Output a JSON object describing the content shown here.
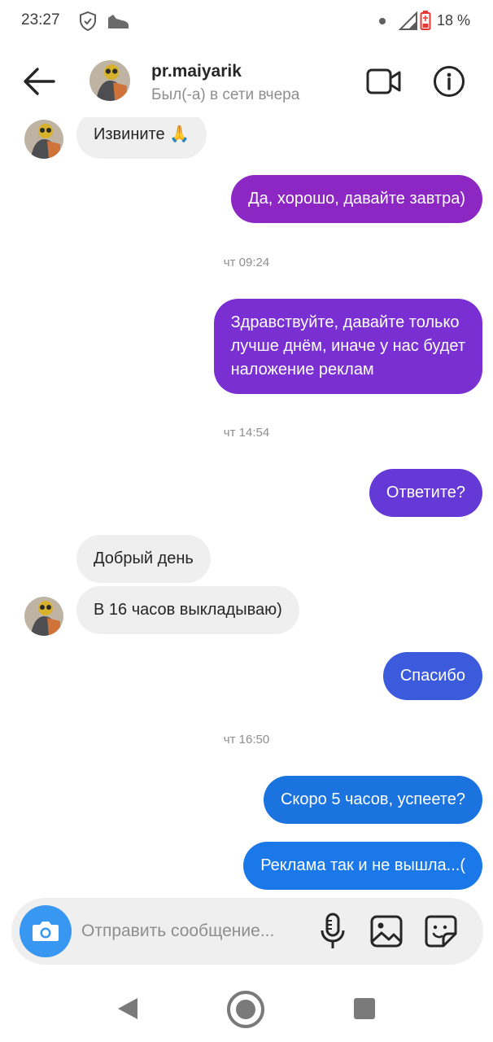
{
  "status_bar": {
    "time": "23:27",
    "battery_percent": "18 %",
    "icons": [
      "shield-icon",
      "shoe-icon",
      "dot-icon",
      "signal-icon",
      "battery-icon"
    ]
  },
  "header": {
    "username": "pr.maiyarik",
    "presence": "Был(-а) в сети вчера",
    "icons": [
      "back-arrow-icon",
      "video-call-icon",
      "info-icon"
    ]
  },
  "messages": [
    {
      "direction": "in",
      "text": "Извините 🙏"
    },
    {
      "direction": "out",
      "text": "Да, хорошо, давайте завтра)",
      "color": "#8c27c4"
    },
    {
      "type": "timestamp",
      "text": "чт 09:24"
    },
    {
      "direction": "out",
      "lines": [
        "Здравствуйте, давайте только",
        "лучше днём, иначе у нас будет",
        "наложение реклам"
      ],
      "color": "#7a2fd2"
    },
    {
      "type": "timestamp",
      "text": "чт 14:54"
    },
    {
      "direction": "out",
      "text": "Ответите?",
      "color": "#6439d6"
    },
    {
      "direction": "in",
      "text": "Добрый день"
    },
    {
      "direction": "in",
      "text": "В 16 часов выкладываю)"
    },
    {
      "direction": "out",
      "text": "Спасибо",
      "color": "#3c5bdc"
    },
    {
      "type": "timestamp",
      "text": "чт 16:50"
    },
    {
      "direction": "out",
      "text": "Скоро 5 часов, успеете?",
      "color": "#1b73e0"
    },
    {
      "direction": "out",
      "text": "Реклама так и не вышла...(",
      "color": "#1a78e8"
    }
  ],
  "composer": {
    "placeholder": "Отправить сообщение...",
    "icons": [
      "camera-icon",
      "microphone-icon",
      "gallery-icon",
      "sticker-icon"
    ]
  },
  "navbar": {
    "icons": [
      "nav-back-icon",
      "nav-home-icon",
      "nav-recents-icon"
    ]
  },
  "colors": {
    "incoming_bubble": "#efefef",
    "camera_button": "#3897f0",
    "muted_text": "#8e8e8e"
  }
}
